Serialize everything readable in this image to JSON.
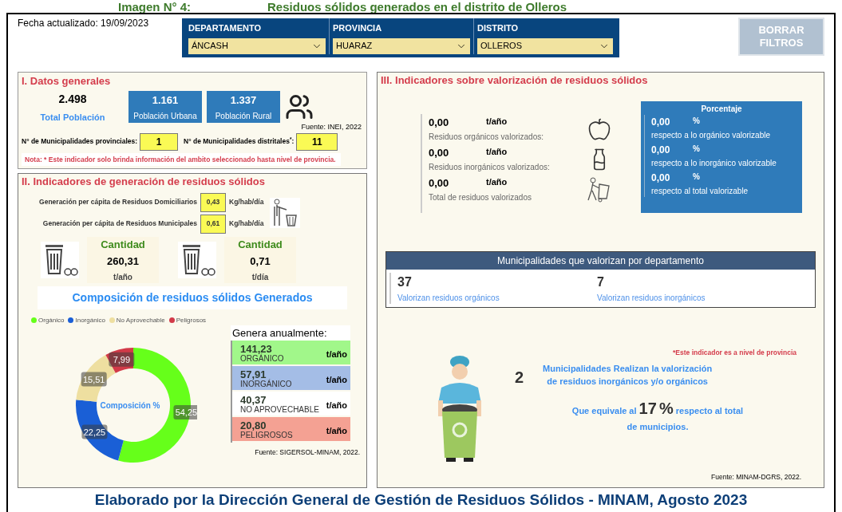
{
  "caption": {
    "number": "Imagen N° 4:",
    "title": "Residuos sólidos generados en el distrito de Olleros"
  },
  "updated": "Fecha actualizado: 19/09/2023",
  "filters": [
    {
      "label": "DEPARTAMENTO",
      "value": "ÁNCASH"
    },
    {
      "label": "PROVINCIA",
      "value": "HUARAZ"
    },
    {
      "label": "DISTRITO",
      "value": "OLLEROS"
    }
  ],
  "clear_button": {
    "label": "BORRAR FILTROS",
    "disabled": true
  },
  "general": {
    "title": "I. Datos generales",
    "total": {
      "value": "2.498",
      "label": "Total Población"
    },
    "cards": [
      {
        "value": "1.161",
        "label": "Población Urbana"
      },
      {
        "value": "1.337",
        "label": "Población Rural"
      }
    ],
    "source": "Fuente: INEI, 2022",
    "counts": [
      {
        "label": "N° de Municipalidades provinciales:",
        "value": "1"
      },
      {
        "label": "N° de Municipalidades distritales$^{*}$:",
        "value": "11"
      }
    ],
    "note": "Nota: * Este indicador solo brinda información del ambito seleccionado hasta nivel de provincia."
  },
  "generation": {
    "title": "II. Indicadores de generación de residuos sólidos",
    "per_capita": [
      {
        "label": "Generación per cápita de Residuos Domiciliarios",
        "value": "0,43",
        "unit": "Kg/hab/día"
      },
      {
        "label": "Generación per cápita de Residuos Municipales",
        "value": "0,61",
        "unit": "Kg/hab/día"
      }
    ],
    "quantities": [
      {
        "heading": "Cantidad",
        "value": "260,31",
        "unit": "t/año"
      },
      {
        "heading": "Cantidad",
        "value": "0,71",
        "unit": "t/día"
      }
    ],
    "composition_title": "Composición de residuos sólidos Generados",
    "chart_data": {
      "type": "donut",
      "categories": [
        "Orgánico",
        "Inorgánico",
        "No Aprovechable",
        "Peligrosos"
      ],
      "series": [
        {
          "name": "Composición %",
          "colors": [
            "#66ff1a",
            "#1a5fd6",
            "#eedfa0",
            "#d23a48"
          ],
          "values": [
            54.25,
            22.25,
            15.51,
            7.99
          ]
        }
      ],
      "value_labels": [
        "54,25",
        "22,25",
        "15,51",
        "7,99"
      ]
    },
    "annual": {
      "heading": "Genera anualmente:",
      "items": [
        {
          "value": "141,23",
          "label": "ORGÁNICO",
          "unit": "t/año",
          "color": "#a1f78a"
        },
        {
          "value": "57,91",
          "label": "INORGÁNICO",
          "unit": "t/año",
          "color": "#a4bde6"
        },
        {
          "value": "40,37",
          "label": "NO APROVECHABLE",
          "unit": "t/año",
          "color": "#ffffff"
        },
        {
          "value": "20,80",
          "label": "PELIGROSOS",
          "unit": "t/año",
          "color": "#f4a193"
        }
      ]
    },
    "source": "Fuente: SIGERSOL-MINAM, 2022."
  },
  "valorization": {
    "title": "III. Indicadores sobre valorización de residuos sólidos",
    "amounts": [
      {
        "value": "0,00",
        "unit": "t/año",
        "label": "Residuos orgánicos valorizados:"
      },
      {
        "value": "0,00",
        "unit": "t/año",
        "label": "Residuos inorgánicos valorizados:"
      },
      {
        "value": "0,00",
        "unit": "t/año",
        "label": "Total de residuos valorizados"
      }
    ],
    "percentage": {
      "title": "Porcentaje",
      "items": [
        {
          "value": "0,00",
          "unit": "%",
          "label": "respecto a lo orgánico valorizable"
        },
        {
          "value": "0,00",
          "unit": "%",
          "label": "respecto a lo inorgánico valorizable"
        },
        {
          "value": "0,00",
          "unit": "%",
          "label": "respecto al total valorizable"
        }
      ]
    },
    "municipalities": {
      "title": "Municipalidades que valorizan por departamento",
      "items": [
        {
          "value": "37",
          "label": "Valorizan residuos orgánicos"
        },
        {
          "value": "7",
          "label": "Valorizan residuos inorgánicos"
        }
      ]
    },
    "note": "*Este indicador es a nivel de provincia",
    "count": "2",
    "count_text": "Municipalidades Realizan la valorización de residuos inorgánicos y/o orgánicos",
    "share_prefix": "Que equivale al",
    "share_value": "17",
    "share_unit": "%",
    "share_suffix": "respecto al total de municipios.",
    "source": "Fuente: MINAM-DGRS, 2022."
  },
  "footer": "Elaborado por la Dirección General de Gestión de Residuos Sólidos - MINAM, Agosto 2023"
}
